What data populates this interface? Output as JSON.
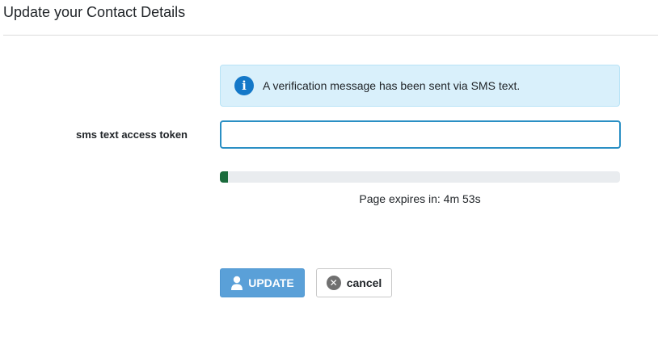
{
  "header": {
    "title": "Update your Contact Details"
  },
  "alert": {
    "icon": "info-icon",
    "text": "A verification message has been sent via SMS text.",
    "color": "#d9f0fb"
  },
  "form": {
    "token_label": "sms text access token",
    "token_value": "",
    "token_placeholder": ""
  },
  "expiry": {
    "progress_fraction": 0.02,
    "progress_color": "#1a6b3c",
    "text": "Page expires in: 4m 53s"
  },
  "actions": {
    "update_label": "UPDATE",
    "update_icon": "user-icon",
    "cancel_label": "cancel",
    "cancel_icon": "close-icon"
  }
}
